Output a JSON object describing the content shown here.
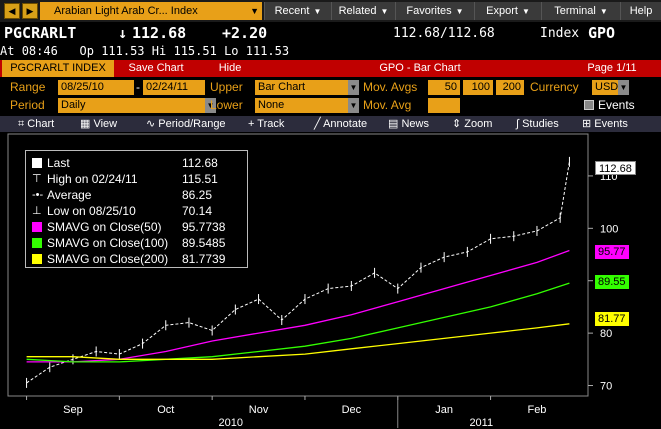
{
  "menu": {
    "back_icon": "back-arrow-icon",
    "forward_icon": "forward-arrow-icon",
    "security_field": "Arabian Light Arab Cr... Index",
    "items": [
      "Recent",
      "Related",
      "Favorites",
      "Export",
      "Terminal",
      "Help"
    ]
  },
  "quote": {
    "ticker": "PGCRARLT",
    "tick_arrow": "↓",
    "last": "112.68",
    "change": "+2.20",
    "bid_ask": "112.68/112.68",
    "type": "Index",
    "function": "GPO",
    "time_label": "At",
    "time": "08:46",
    "open_label": "Op",
    "open": "111.53",
    "high_label": "Hi",
    "high": "115.51",
    "low_label": "Lo",
    "low": "111.53"
  },
  "tabs": {
    "security": "PGCRARLT INDEX",
    "save": "Save Chart",
    "hide": "Hide",
    "title": "GPO - Bar Chart",
    "page": "Page 1/11"
  },
  "settings": {
    "range_label": "Range",
    "range_start": "08/25/10",
    "range_sep": "-",
    "range_end": "02/24/11",
    "upper_label": "Upper",
    "upper_value": "Bar Chart",
    "movavgs_label": "Mov. Avgs",
    "ma1": "50",
    "ma2": "100",
    "ma3": "200",
    "currency_label": "Currency",
    "currency": "USD",
    "period_label": "Period",
    "period_value": "Daily",
    "lower_label": "Lower",
    "lower_value": "None",
    "movavg_label": "Mov. Avg",
    "movavg_value": "",
    "events_label": "Events"
  },
  "toolbar": {
    "chart": "Chart",
    "view": "View",
    "period": "Period/Range",
    "track": "Track",
    "annotate": "Annotate",
    "news": "News",
    "zoom": "Zoom",
    "studies": "Studies",
    "events": "Events"
  },
  "legend": [
    {
      "label": "Last",
      "value": "112.68",
      "marker": "square",
      "color": "#ffffff"
    },
    {
      "label": "High on 02/24/11",
      "value": "115.51",
      "marker": "high-tick",
      "color": "#ffffff"
    },
    {
      "label": "Average",
      "value": "86.25",
      "marker": "average-line",
      "color": "#ffffff"
    },
    {
      "label": "Low on 08/25/10",
      "value": "70.14",
      "marker": "low-tick",
      "color": "#ffffff"
    },
    {
      "label": "SMAVG on Close(50)",
      "value": "95.7738",
      "marker": "square",
      "color": "#ff00ff"
    },
    {
      "label": "SMAVG on Close(100)",
      "value": "89.5485",
      "marker": "square",
      "color": "#33ff00"
    },
    {
      "label": "SMAVG on Close(200)",
      "value": "81.7739",
      "marker": "square",
      "color": "#ffff00"
    }
  ],
  "value_tags": {
    "last": {
      "text": "112.68",
      "color": "#ffffff"
    },
    "sma50": {
      "text": "95.77",
      "color": "#ff00ff"
    },
    "sma100": {
      "text": "89.55",
      "color": "#33ff00"
    },
    "sma200": {
      "text": "81.77",
      "color": "#ffff00"
    }
  },
  "chart_data": {
    "type": "line",
    "title": "GPO - Bar Chart",
    "xlabel": "",
    "ylabel": "",
    "ylim": [
      68,
      118
    ],
    "yticks": [
      70,
      80,
      90,
      100,
      110
    ],
    "ytick_labels": [
      "70",
      "80",
      "90",
      "100",
      "110"
    ],
    "months": [
      "Sep",
      "Oct",
      "Nov",
      "Dec",
      "Jan",
      "Feb"
    ],
    "month_positions": [
      0.5,
      1.5,
      2.5,
      3.5,
      4.5,
      5.5
    ],
    "years": [
      "2010",
      "2011"
    ],
    "year_positions": [
      2.2,
      4.9
    ],
    "x_range": [
      -0.2,
      6.05
    ],
    "grid": false,
    "legend_position": "top-left",
    "series": [
      {
        "name": "Last",
        "color": "#ffffff",
        "style": "bar",
        "x": [
          0.0,
          0.25,
          0.5,
          0.75,
          1.0,
          1.25,
          1.5,
          1.75,
          2.0,
          2.25,
          2.5,
          2.75,
          3.0,
          3.25,
          3.5,
          3.75,
          4.0,
          4.25,
          4.5,
          4.75,
          5.0,
          5.25,
          5.5,
          5.75,
          5.85
        ],
        "values": [
          70.5,
          73.5,
          75.0,
          76.5,
          76.0,
          78.0,
          81.5,
          82.0,
          80.5,
          84.5,
          86.5,
          82.5,
          86.5,
          88.5,
          89.0,
          91.5,
          88.5,
          92.5,
          94.5,
          95.5,
          98.0,
          98.5,
          99.5,
          102.0,
          112.68
        ]
      },
      {
        "name": "SMAVG on Close(50)",
        "color": "#ff00ff",
        "style": "line",
        "x": [
          0.0,
          0.5,
          1.0,
          1.5,
          2.0,
          2.5,
          3.0,
          3.5,
          4.0,
          4.5,
          5.0,
          5.5,
          5.85
        ],
        "values": [
          74.5,
          74.5,
          75.0,
          76.5,
          78.5,
          80.0,
          81.5,
          83.5,
          86.0,
          88.5,
          91.0,
          93.5,
          95.77
        ]
      },
      {
        "name": "SMAVG on Close(100)",
        "color": "#33ff00",
        "style": "line",
        "x": [
          0.0,
          0.5,
          1.0,
          1.5,
          2.0,
          2.5,
          3.0,
          3.5,
          4.0,
          4.5,
          5.0,
          5.5,
          5.85
        ],
        "values": [
          75.0,
          74.5,
          74.5,
          75.0,
          75.5,
          76.5,
          77.5,
          79.0,
          81.0,
          83.0,
          85.0,
          87.5,
          89.55
        ]
      },
      {
        "name": "SMAVG on Close(200)",
        "color": "#ffff00",
        "style": "line",
        "x": [
          0.0,
          0.5,
          1.0,
          1.5,
          2.0,
          2.5,
          3.0,
          3.5,
          4.0,
          4.5,
          5.0,
          5.5,
          5.85
        ],
        "values": [
          75.5,
          75.5,
          75.0,
          75.0,
          75.0,
          75.5,
          76.0,
          77.0,
          78.0,
          79.0,
          80.0,
          81.0,
          81.77
        ]
      }
    ]
  }
}
